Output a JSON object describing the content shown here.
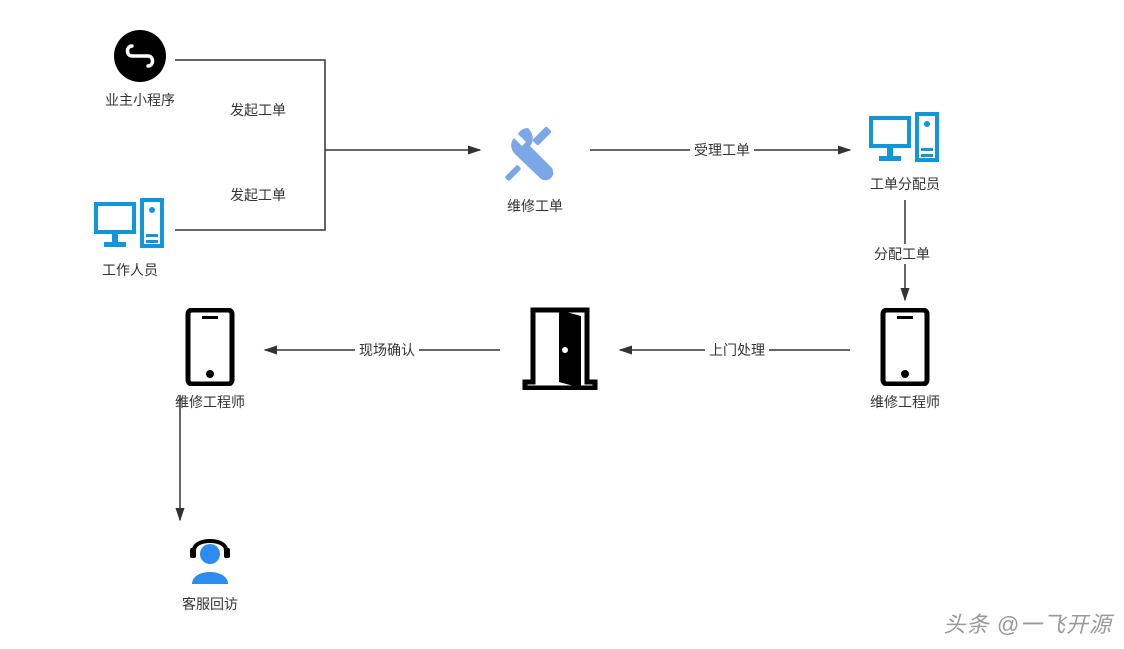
{
  "nodes": {
    "owner_app": {
      "label": "业主小程序"
    },
    "staff": {
      "label": "工作人员"
    },
    "work_order": {
      "label": "维修工单"
    },
    "dispatcher": {
      "label": "工单分配员"
    },
    "engineer1": {
      "label": "维修工程师"
    },
    "door": {
      "label": ""
    },
    "engineer2": {
      "label": "维修工程师"
    },
    "callback": {
      "label": "客服回访"
    }
  },
  "edges": {
    "create_order_1": "发起工单",
    "create_order_2": "发起工单",
    "accept_order": "受理工单",
    "assign_order": "分配工单",
    "onsite": "上门处理",
    "confirm": "现场确认"
  },
  "watermark": "头条 @一飞开源"
}
